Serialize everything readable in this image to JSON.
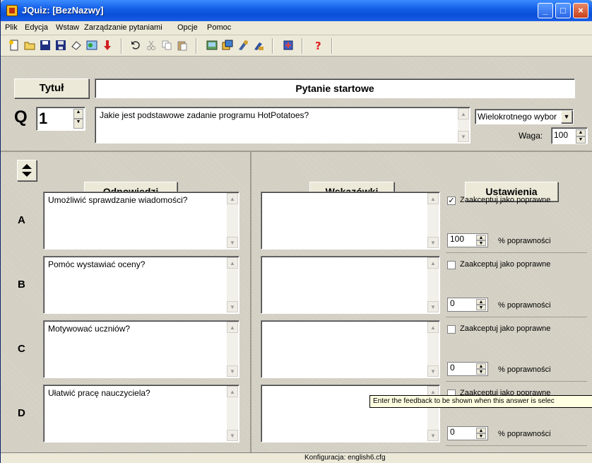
{
  "window": {
    "title": "JQuiz: [BezNazwy]",
    "min": "_",
    "max": "□",
    "close": "×"
  },
  "menu": [
    "Plik",
    "Edycja",
    "Wstaw",
    "Zarządzanie pytaniami",
    "Opcje",
    "Pomoc"
  ],
  "toolbar": {
    "icons": [
      "new-file-icon",
      "open-folder-icon",
      "save-icon",
      "save-as-icon",
      "eraser-icon",
      "web-page-icon",
      "down-arrow-icon",
      "undo-icon",
      "cut-icon",
      "copy-icon",
      "paste-icon",
      "export-icon",
      "export-2-icon",
      "tool-icon",
      "tool-2-icon",
      "help-book-icon",
      "help-icon"
    ]
  },
  "header": {
    "title_button": "Tytuł",
    "title_value": "Pytanie startowe",
    "q_label": "Q",
    "q_number": "1",
    "question_text": "Jakie jest podstawowe zadanie programu HotPotatoes?",
    "question_type": "Wielokrotnego wybor",
    "weight_label": "Waga:",
    "weight_value": "100"
  },
  "columns": {
    "answers": "Odpowiedzi",
    "feedback": "Wskazówki",
    "settings": "Ustawienia"
  },
  "answers": [
    {
      "letter": "A",
      "text": "Umożliwić sprawdzanie wiadomości?",
      "feedback": "",
      "accept_label": "Zaakceptuj jako poprawne",
      "accepted": true,
      "percent": "100",
      "percent_label": "% poprawności"
    },
    {
      "letter": "B",
      "text": "Pomóc wystawiać oceny?",
      "feedback": "",
      "accept_label": "Zaakceptuj jako poprawne",
      "accepted": false,
      "percent": "0",
      "percent_label": "% poprawności"
    },
    {
      "letter": "C",
      "text": "Motywować uczniów?",
      "feedback": "",
      "accept_label": "Zaakceptuj jako poprawne",
      "accepted": false,
      "percent": "0",
      "percent_label": "% poprawności"
    },
    {
      "letter": "D",
      "text": "Ułatwić pracę nauczyciela?",
      "feedback": "",
      "accept_label": "Zaakceptuj jako poprawne",
      "accepted": false,
      "percent": "0",
      "percent_label": "% poprawności"
    }
  ],
  "tooltip": "Enter the feedback to be shown when this answer is selec",
  "status": "Konfiguracja: english6.cfg",
  "checkmark": "✓"
}
